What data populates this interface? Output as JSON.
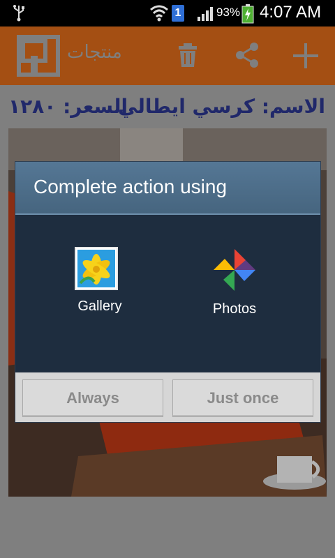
{
  "status_bar": {
    "sim_number": "1",
    "battery_percent": "93%",
    "time": "4:07 AM"
  },
  "app_bar": {
    "title": "منتجات",
    "actions": [
      "delete-icon",
      "share-icon",
      "add-icon"
    ]
  },
  "product": {
    "name_line": "الاسم: كرسي ايطالي",
    "price_line": "السعر: ١٢٨٠"
  },
  "dialog": {
    "title": "Complete action using",
    "apps": [
      {
        "label": "Gallery"
      },
      {
        "label": "Photos"
      }
    ],
    "buttons": {
      "always": "Always",
      "just_once": "Just once"
    }
  },
  "colors": {
    "app_bar": "#a44f13",
    "dialog_body": "#1e2d3f",
    "dialog_title": "#557795",
    "product_text": "#20286a"
  }
}
